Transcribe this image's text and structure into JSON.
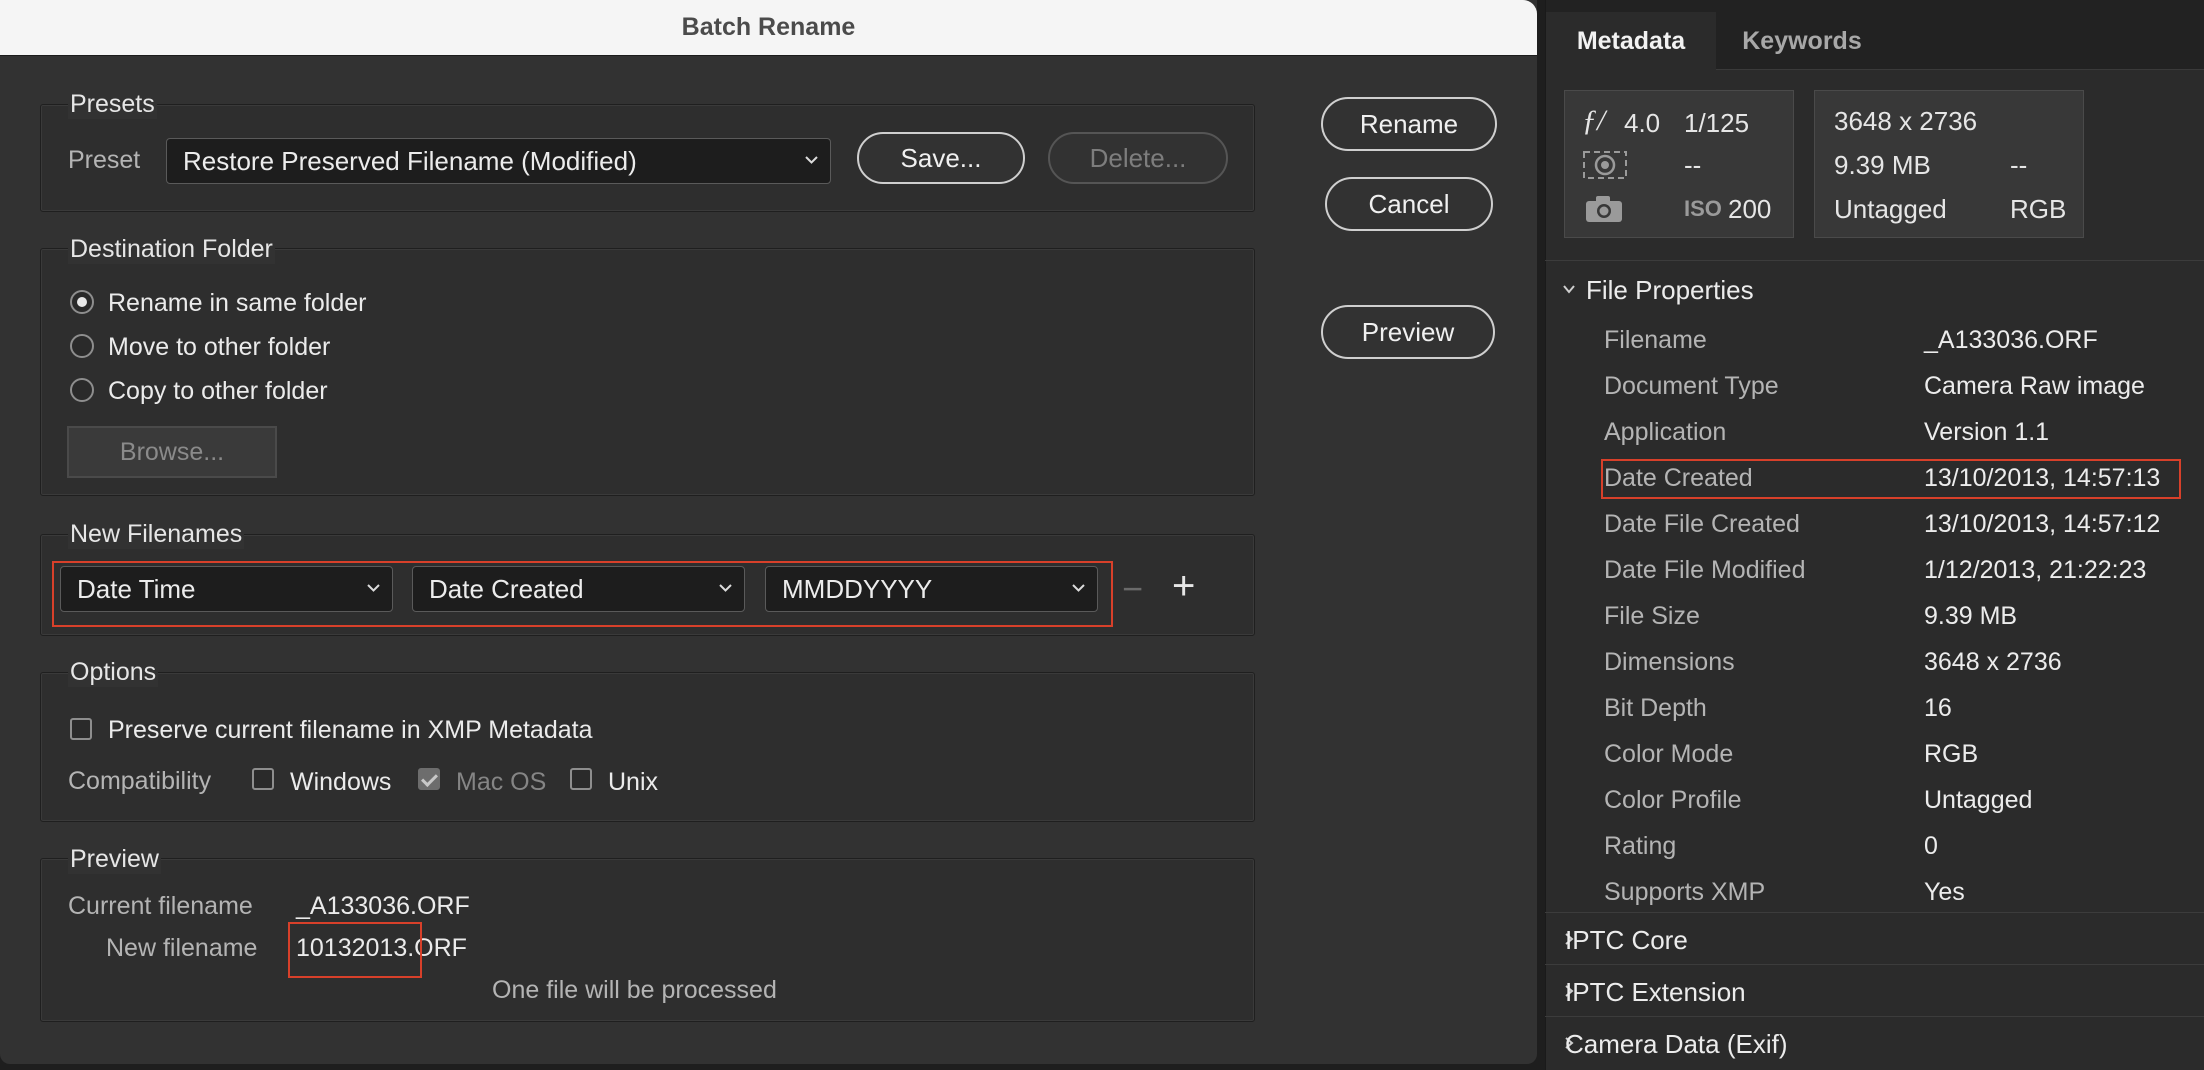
{
  "dialog": {
    "title": "Batch Rename",
    "buttons": {
      "rename": "Rename",
      "cancel": "Cancel",
      "preview": "Preview"
    },
    "presets": {
      "legend": "Presets",
      "preset_label": "Preset",
      "preset_value": "Restore Preserved Filename (Modified)",
      "save": "Save...",
      "delete": "Delete..."
    },
    "destination": {
      "legend": "Destination Folder",
      "options": [
        "Rename in same folder",
        "Move to other folder",
        "Copy to other folder"
      ],
      "selected": "Rename in same folder",
      "browse": "Browse..."
    },
    "new_filenames": {
      "legend": "New Filenames",
      "field1": "Date Time",
      "field2": "Date Created",
      "field3": "MMDDYYYY",
      "remove": "−",
      "add": "+"
    },
    "options": {
      "legend": "Options",
      "preserve": "Preserve current filename in XMP Metadata",
      "preserve_checked": false,
      "compat_label": "Compatibility",
      "compat": [
        {
          "label": "Windows",
          "checked": false
        },
        {
          "label": "Mac OS",
          "checked": true
        },
        {
          "label": "Unix",
          "checked": false
        }
      ]
    },
    "preview": {
      "legend": "Preview",
      "current_label": "Current filename",
      "current_value": "_A133036.ORF",
      "new_label": "New filename",
      "new_value": "10132013.ORF",
      "status": "One file will be processed"
    }
  },
  "metadata_panel": {
    "tabs": [
      "Metadata",
      "Keywords"
    ],
    "active_tab": "Metadata",
    "camera": {
      "aperture_symbol": "ƒ/",
      "aperture": "4.0",
      "shutter": "1/125",
      "metering": "--",
      "iso_label": "ISO",
      "iso": "200"
    },
    "image": {
      "dimensions": "3648 x 2736",
      "size": "9.39 MB",
      "res": "--",
      "profile": "Untagged",
      "mode": "RGB"
    },
    "file_properties": {
      "title": "File Properties",
      "rows": [
        {
          "key": "Filename",
          "value": "_A133036.ORF"
        },
        {
          "key": "Document Type",
          "value": "Camera Raw image"
        },
        {
          "key": "Application",
          "value": "Version 1.1"
        },
        {
          "key": "Date Created",
          "value": "13/10/2013, 14:57:13"
        },
        {
          "key": "Date File Created",
          "value": "13/10/2013, 14:57:12"
        },
        {
          "key": "Date File Modified",
          "value": "1/12/2013, 21:22:23"
        },
        {
          "key": "File Size",
          "value": "9.39 MB"
        },
        {
          "key": "Dimensions",
          "value": "3648 x 2736"
        },
        {
          "key": "Bit Depth",
          "value": "16"
        },
        {
          "key": "Color Mode",
          "value": "RGB"
        },
        {
          "key": "Color Profile",
          "value": "Untagged"
        },
        {
          "key": "Rating",
          "value": "0"
        },
        {
          "key": "Supports XMP",
          "value": "Yes"
        }
      ]
    },
    "collapsed_sections": [
      "IPTC Core",
      "IPTC Extension",
      "Camera Data (Exif)"
    ]
  }
}
